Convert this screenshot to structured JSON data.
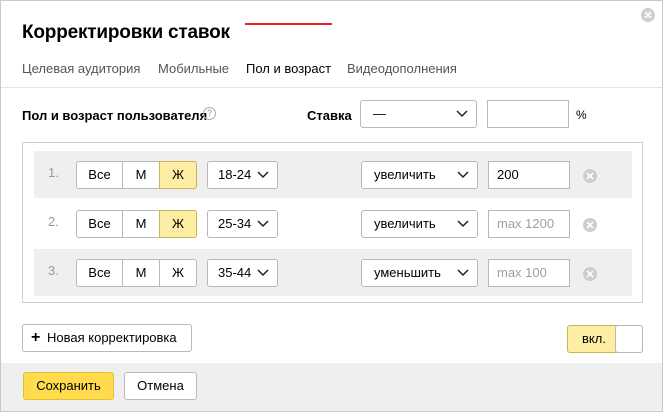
{
  "dialog": {
    "title": "Корректировки ставок"
  },
  "tabs": [
    {
      "label": "Целевая аудитория",
      "active": false
    },
    {
      "label": "Мобильные",
      "active": false
    },
    {
      "label": "Пол и возраст",
      "active": true
    },
    {
      "label": "Видеодополнения",
      "active": false
    }
  ],
  "header": {
    "section_label": "Пол и возраст пользователя",
    "help_glyph": "?",
    "stavka_label": "Ставка",
    "stavka_select_value": "—",
    "stavka_input_value": "",
    "percent_sign": "%"
  },
  "gender_options": [
    "Все",
    "М",
    "Ж"
  ],
  "rows": [
    {
      "num": "1.",
      "gender_selected": "Ж",
      "age": "18-24",
      "action": "увеличить",
      "value": "200",
      "placeholder": ""
    },
    {
      "num": "2.",
      "gender_selected": "Ж",
      "age": "25-34",
      "action": "увеличить",
      "value": "",
      "placeholder": "max 1200"
    },
    {
      "num": "3.",
      "gender_selected": "",
      "age": "35-44",
      "action": "уменьшить",
      "value": "",
      "placeholder": "max 100"
    }
  ],
  "footer_controls": {
    "new_button_plus": "+",
    "new_button_label": "Новая корректировка",
    "toggle_label": "вкл.",
    "toggle_on": true
  },
  "footer": {
    "save_label": "Сохранить",
    "cancel_label": "Отмена"
  },
  "colors": {
    "accent_yellow": "#ffdb4d",
    "selected_yellow": "#fdeea3",
    "tab_underline": "#e3242b"
  }
}
